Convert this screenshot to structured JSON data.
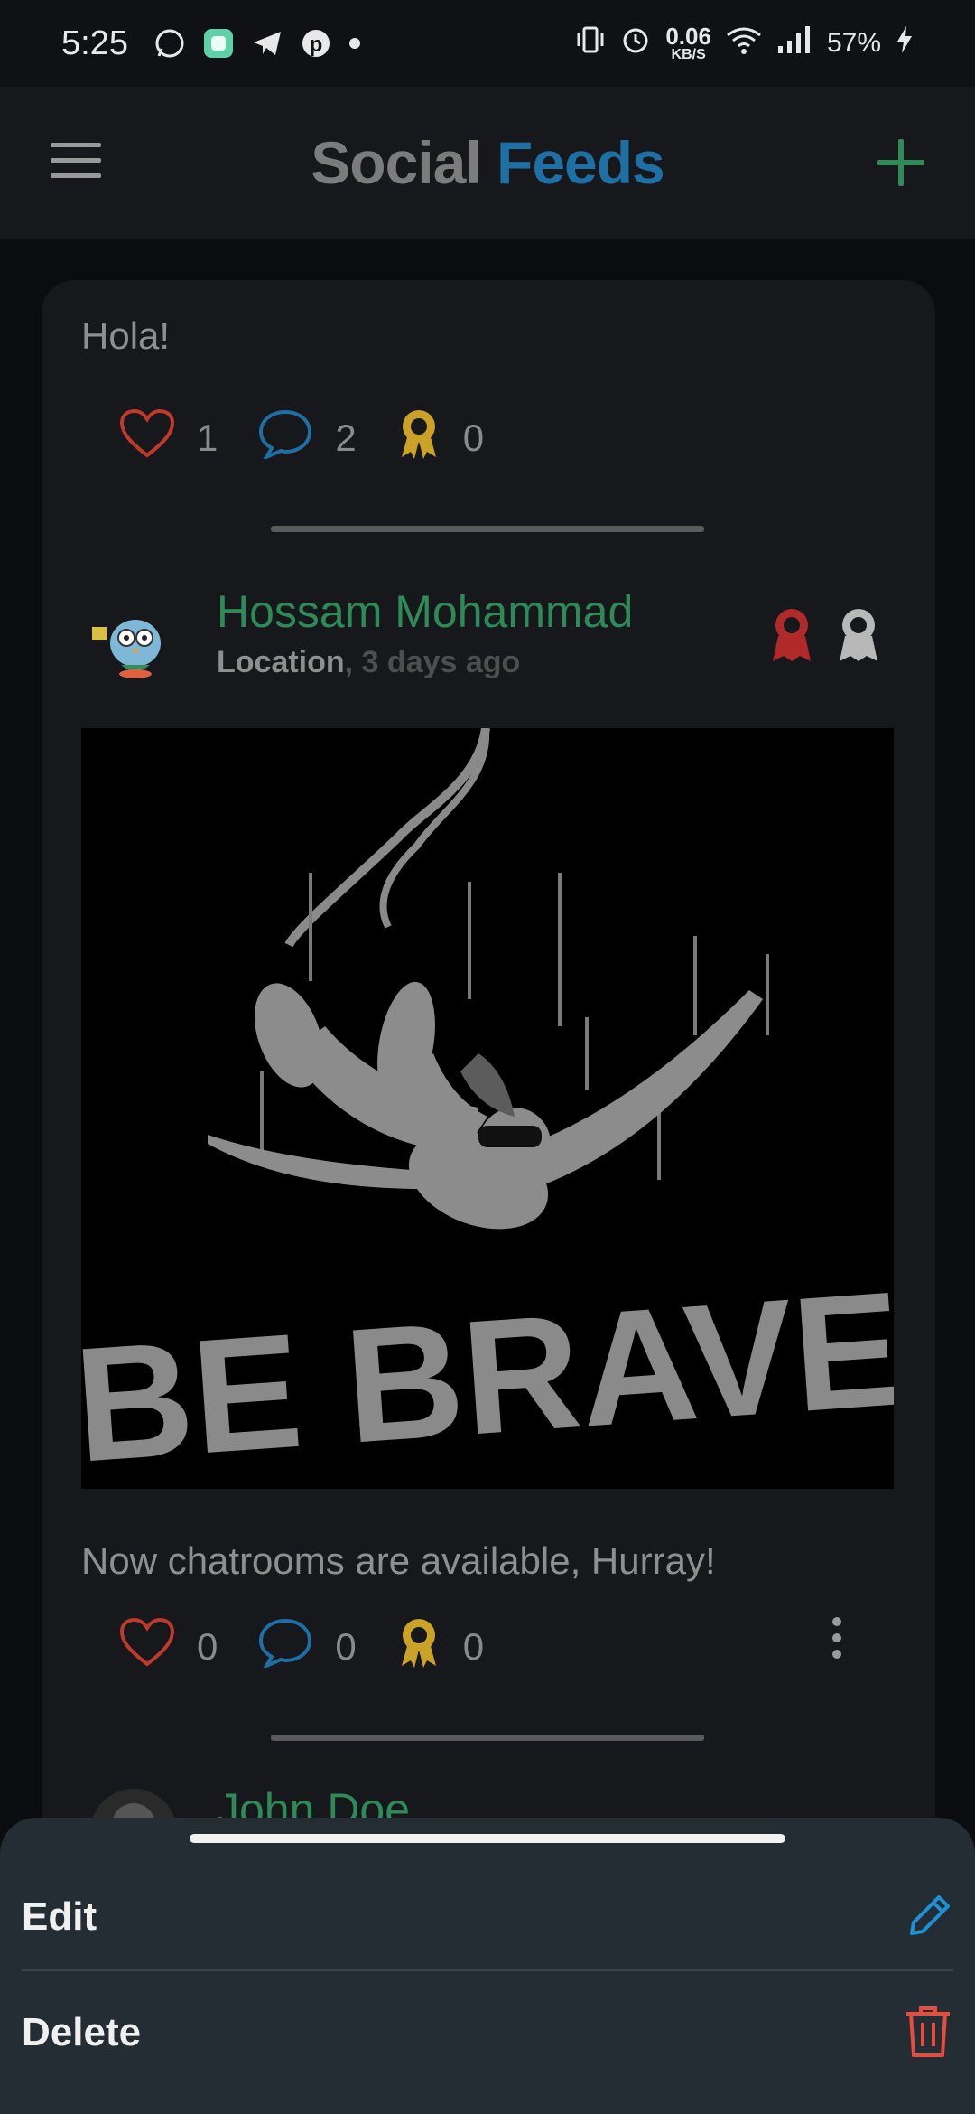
{
  "status_bar": {
    "time": "5:25",
    "net_speed": "0.06",
    "net_unit": "KB/S",
    "battery": "57%"
  },
  "app_bar": {
    "title_part1": "Social",
    "title_part2": "Feeds"
  },
  "posts": [
    {
      "text": "Hola!",
      "likes": "1",
      "comments": "2",
      "awards": "0"
    },
    {
      "author": "Hossam Mohammad",
      "location": "Location",
      "time_ago": ", 3 days ago",
      "image_text": "BE BRAVE",
      "text": "Now chatrooms are available, Hurray!",
      "likes": "0",
      "comments": "0",
      "awards": "0"
    },
    {
      "author": "John Doe"
    }
  ],
  "sheet": {
    "edit_label": "Edit",
    "delete_label": "Delete"
  },
  "colors": {
    "accent_green": "#2e8b57",
    "accent_blue": "#1e6fa3",
    "like_red": "#c0392b",
    "award_gold": "#c9a227",
    "edit_blue": "#1e90d6",
    "delete_red": "#e74c3c"
  }
}
